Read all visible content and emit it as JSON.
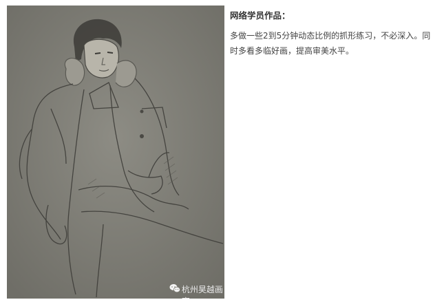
{
  "post": {
    "title": "网络学员作品：",
    "description": "多做一些2到5分钟动态比例的抓形练习，不必深入。同时多看多临好画，提高审美水平。"
  },
  "artwork": {
    "watermark_text": "杭州昊越画室",
    "watermark_icon": "wechat-icon",
    "background_color": "#7f7e76"
  }
}
